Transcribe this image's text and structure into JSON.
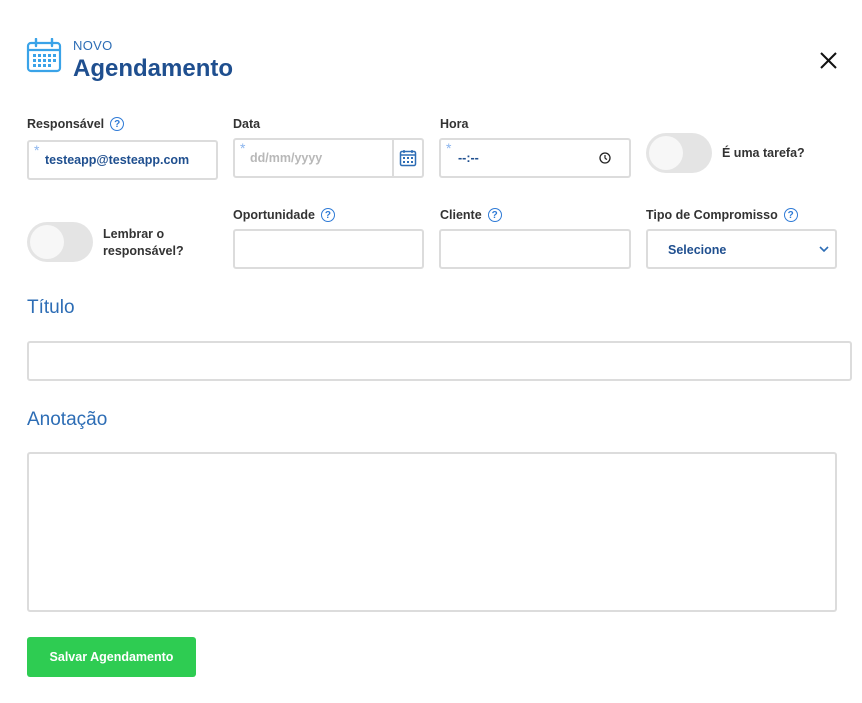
{
  "header": {
    "pretitle": "NOVO",
    "title": "Agendamento"
  },
  "form": {
    "responsavel": {
      "label": "Responsável",
      "value": "testeapp@testeapp.com",
      "required_mark": "*"
    },
    "data": {
      "label": "Data",
      "placeholder": "dd/mm/yyyy",
      "required_mark": "*"
    },
    "hora": {
      "label": "Hora",
      "value": "--:--",
      "required_mark": "*"
    },
    "tarefa_toggle": {
      "label": "É uma tarefa?",
      "on": false
    },
    "lembrar_toggle": {
      "label_line1": "Lembrar o",
      "label_line2": "responsável?",
      "on": false
    },
    "oportunidade": {
      "label": "Oportunidade",
      "value": ""
    },
    "cliente": {
      "label": "Cliente",
      "value": ""
    },
    "tipo": {
      "label": "Tipo de Compromisso",
      "selected": "Selecione"
    },
    "titulo": {
      "label": "Título",
      "value": ""
    },
    "anotacao": {
      "label": "Anotação",
      "value": ""
    },
    "save_label": "Salvar Agendamento"
  },
  "help_glyph": "?",
  "colors": {
    "brand_dark": "#1f4f8f",
    "brand": "#2d6db5",
    "accent": "#2e7ad6",
    "save": "#2ecc52",
    "border": "#dcdcdc"
  },
  "icons": [
    "calendar-icon",
    "close-icon",
    "help-icon",
    "clock-icon",
    "chevron-down-icon"
  ]
}
